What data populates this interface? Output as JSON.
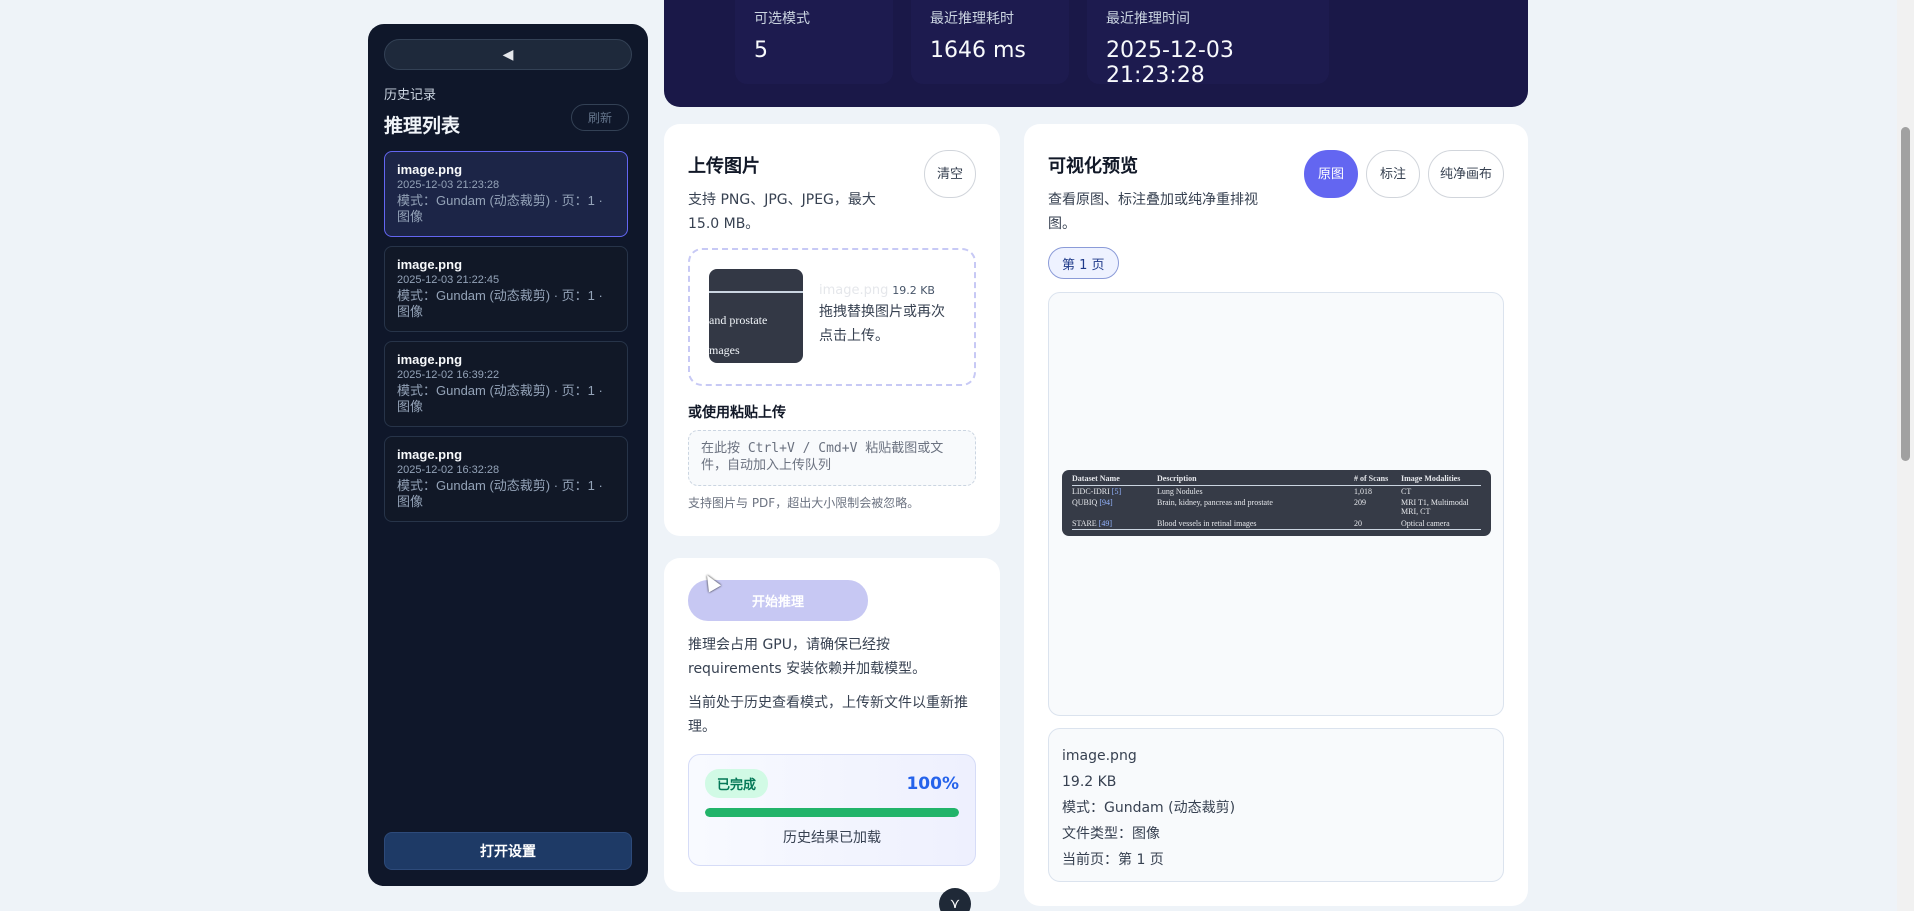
{
  "sidebar": {
    "collapse_label": "◀",
    "history_sub": "历史记录",
    "title": "推理列表",
    "refresh_label": "刷新",
    "items": [
      {
        "name": "image.png",
        "time": "2025-12-03 21:23:28",
        "meta": "模式：Gundam (动态裁剪) · 页：1 · 图像"
      },
      {
        "name": "image.png",
        "time": "2025-12-03 21:22:45",
        "meta": "模式：Gundam (动态裁剪) · 页：1 · 图像"
      },
      {
        "name": "image.png",
        "time": "2025-12-02 16:39:22",
        "meta": "模式：Gundam (动态裁剪) · 页：1 · 图像"
      },
      {
        "name": "image.png",
        "time": "2025-12-02 16:32:28",
        "meta": "模式：Gundam (动态裁剪) · 页：1 · 图像"
      }
    ],
    "settings_label": "打开设置"
  },
  "stats": [
    {
      "label": "可选模式",
      "value": "5"
    },
    {
      "label": "最近推理耗时",
      "value": "1646 ms"
    },
    {
      "label": "最近推理时间",
      "value": "2025-12-03 21:23:28"
    }
  ],
  "upload": {
    "title": "上传图片",
    "desc": "支持 PNG、JPG、JPEG，最大 15.0 MB。",
    "clear_label": "清空",
    "thumb_line1": "and prostate",
    "thumb_line2": "mages",
    "file_name": "image.png",
    "file_size": "19.2 KB",
    "drop_hint": "拖拽替换图片或再次点击上传。",
    "paste_title": "或使用粘贴上传",
    "paste_placeholder": "在此按 Ctrl+V / Cmd+V 粘贴截图或文件，自动加入上传队列",
    "paste_note": "支持图片与 PDF，超出大小限制会被忽略。"
  },
  "inference": {
    "start_label": "开始推理",
    "gpu_note": "推理会占用 GPU，请确保已经按 requirements 安装依赖并加载模型。",
    "history_note": "当前处于历史查看模式，上传新文件以重新推理。",
    "status_badge": "已完成",
    "percent_label": "100%",
    "progress": 1.0,
    "progress_msg": "历史结果已加载"
  },
  "preview": {
    "title": "可视化预览",
    "desc": "查看原图、标注叠加或纯净重排视图。",
    "tabs": [
      "原图",
      "标注",
      "纯净画布"
    ],
    "active_tab": 0,
    "page_chip": "第 1 页",
    "table": {
      "headers": [
        "Dataset Name",
        "Description",
        "# of Scans",
        "Image Modalities"
      ],
      "rows": [
        {
          "name": "LIDC-IDRI",
          "ref": "[5]",
          "desc": "Lung Nodules",
          "scans": "1,018",
          "modality": "CT"
        },
        {
          "name": "QUBIQ",
          "ref": "[94]",
          "desc": "Brain, kidney, pancreas and prostate",
          "scans": "209",
          "modality": "MRI T1, Multimodal MRI, CT"
        },
        {
          "name": "STARE",
          "ref": "[49]",
          "desc": "Blood vessels in retinal images",
          "scans": "20",
          "modality": "Optical camera"
        }
      ]
    },
    "meta": {
      "file_name": "image.png",
      "file_size": "19.2 KB",
      "mode": "模式：Gundam (动态裁剪)",
      "file_type": "文件类型：图像",
      "current_page": "当前页：第 1 页"
    }
  },
  "scroll_down_label": "⋎"
}
